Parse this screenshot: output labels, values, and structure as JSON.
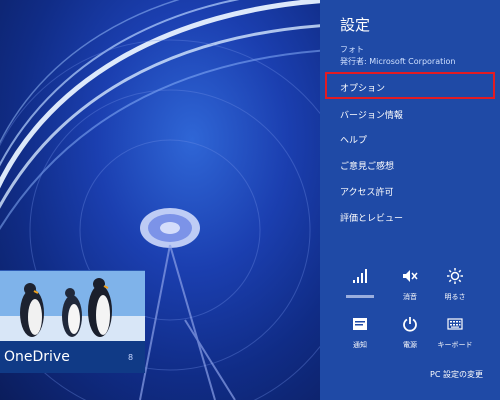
{
  "tile": {
    "app_name": "OneDrive",
    "count": "8"
  },
  "panel": {
    "title": "設定",
    "app": "フォト",
    "publisher": "発行者: Microsoft Corporation",
    "menu": [
      {
        "label": "オプション"
      },
      {
        "label": "バージョン情報"
      },
      {
        "label": "ヘルプ"
      },
      {
        "label": "ご意見ご感想"
      },
      {
        "label": "アクセス許可"
      },
      {
        "label": "評価とレビュー"
      }
    ],
    "quick": [
      {
        "label": "",
        "icon": "wifi-signal-icon"
      },
      {
        "label": "消音",
        "icon": "volume-mute-icon"
      },
      {
        "label": "明るさ",
        "icon": "brightness-icon"
      },
      {
        "label": "通知",
        "icon": "notifications-icon"
      },
      {
        "label": "電源",
        "icon": "power-icon"
      },
      {
        "label": "キーボード",
        "icon": "keyboard-icon"
      }
    ],
    "pc_settings": "PC 設定の変更"
  },
  "colors": {
    "panel": "#1f4aa6",
    "highlight": "#e31b23"
  }
}
